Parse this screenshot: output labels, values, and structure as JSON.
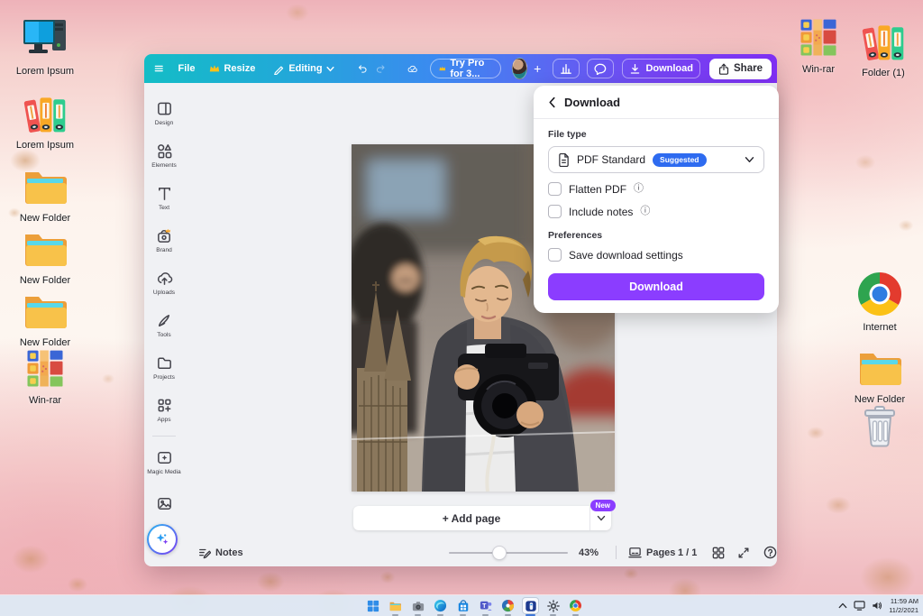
{
  "colors": {
    "accent_purple": "#8b3dff",
    "suggested_blue": "#2e6bf0",
    "toolbar_teal": "#14bdc6",
    "toolbar_purple": "#7e2ff2",
    "taskbar_bg": "#dee9f5"
  },
  "desktop": {
    "left_icons": [
      {
        "label": "Lorem Ipsum",
        "icon": "computer-icon"
      },
      {
        "label": "Lorem Ipsum",
        "icon": "binders-icon"
      },
      {
        "label": "New Folder",
        "icon": "folder-icon"
      },
      {
        "label": "New Folder",
        "icon": "folder-icon"
      },
      {
        "label": "New Folder",
        "icon": "folder-icon"
      },
      {
        "label": "Win-rar",
        "icon": "winrar-icon"
      }
    ],
    "top_right_icons": [
      {
        "label": "Win-rar",
        "icon": "winrar-icon"
      },
      {
        "label": "Folder (1)",
        "icon": "binders-icon"
      }
    ],
    "right_icons": [
      {
        "label": "Internet",
        "icon": "chrome-icon"
      },
      {
        "label": "New Folder",
        "icon": "folder-icon"
      },
      {
        "label": "",
        "icon": "trash-icon"
      }
    ]
  },
  "editor": {
    "toolbar": {
      "file": "File",
      "resize": "Resize",
      "editing": "Editing",
      "try_pro": "Try Pro for 3...",
      "download": "Download",
      "share": "Share"
    },
    "sidebar": [
      {
        "label": "Design"
      },
      {
        "label": "Elements"
      },
      {
        "label": "Text"
      },
      {
        "label": "Brand"
      },
      {
        "label": "Uploads"
      },
      {
        "label": "Tools"
      },
      {
        "label": "Projects"
      },
      {
        "label": "Apps"
      },
      {
        "label": "Magic Media"
      },
      {
        "label": ""
      }
    ],
    "canvas": {
      "add_page": "+ Add page",
      "new_badge": "New"
    },
    "bottom_bar": {
      "notes": "Notes",
      "zoom": "43%",
      "pages": "Pages",
      "page_indicator": "1 / 1"
    },
    "download_panel": {
      "title": "Download",
      "file_type_label": "File type",
      "file_type_value": "PDF Standard",
      "suggested_badge": "Suggested",
      "flatten_pdf": "Flatten PDF",
      "include_notes": "Include notes",
      "preferences": "Preferences",
      "save_settings": "Save download settings",
      "download_button": "Download"
    }
  },
  "taskbar": {
    "time": "11:59 AM",
    "date": "11/2/2021"
  }
}
